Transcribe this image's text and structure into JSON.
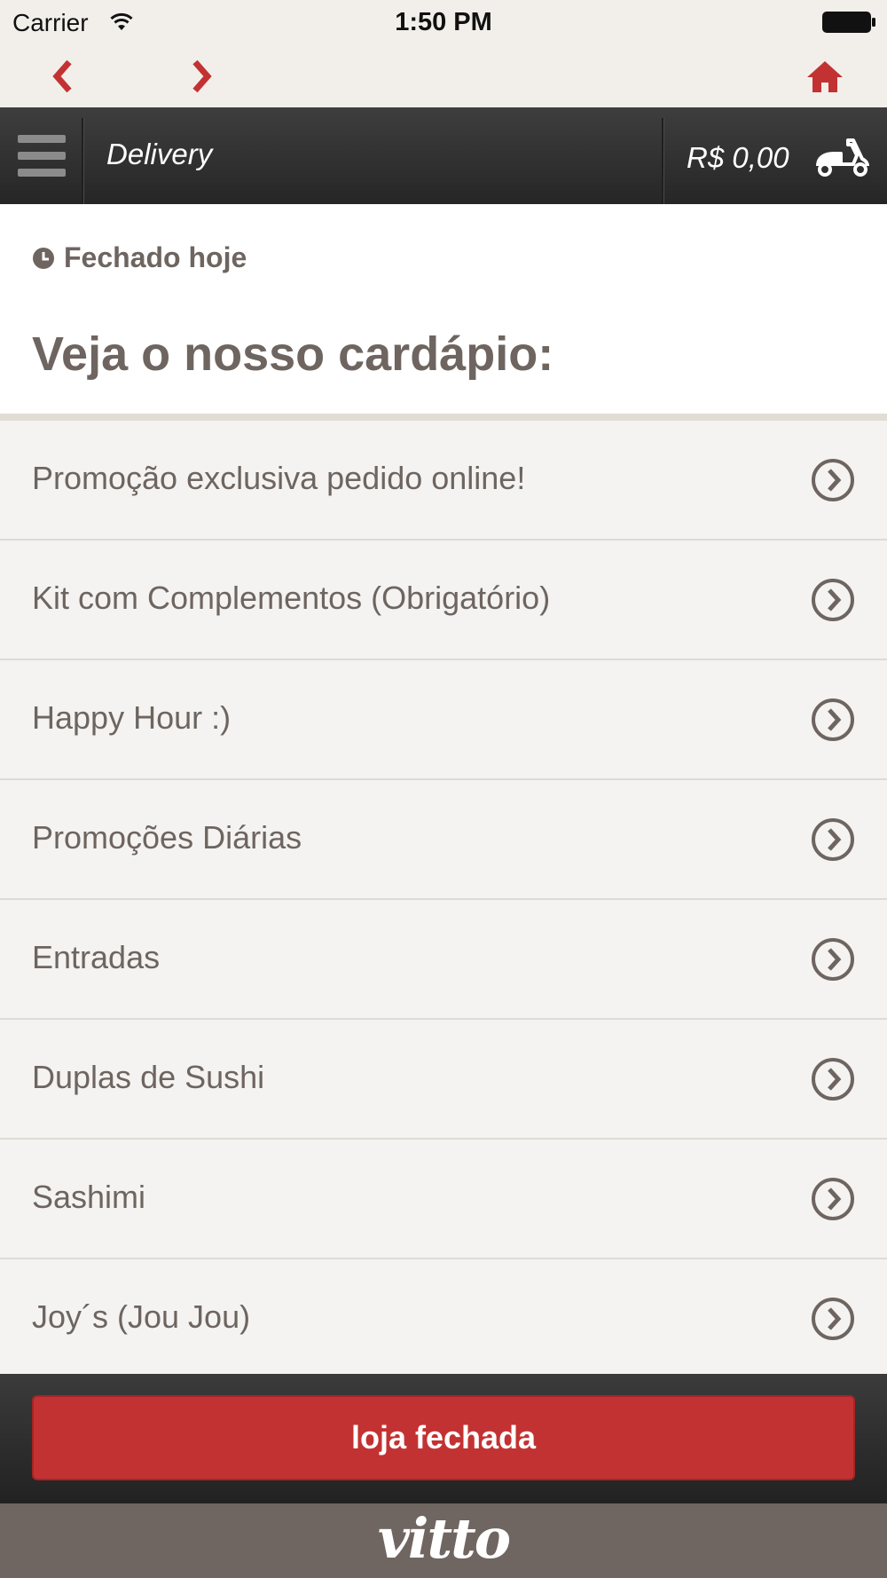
{
  "status_bar": {
    "carrier": "Carrier",
    "time": "1:50 PM"
  },
  "header": {
    "title": "Delivery",
    "cart_total": "R$ 0,00"
  },
  "store": {
    "hours_status": "Fechado hoje",
    "menu_heading": "Veja o nosso cardápio:"
  },
  "menu": {
    "items": [
      {
        "label": "Promoção exclusiva pedido online!"
      },
      {
        "label": "Kit com Complementos (Obrigatório)"
      },
      {
        "label": "Happy Hour :)"
      },
      {
        "label": "Promoções Diárias"
      },
      {
        "label": "Entradas"
      },
      {
        "label": "Duplas de Sushi"
      },
      {
        "label": "Sashimi"
      },
      {
        "label": "Joy´s (Jou Jou)"
      }
    ]
  },
  "footer": {
    "button_label": "loja fechada",
    "brand": "vitto"
  },
  "colors": {
    "accent": "#c33232",
    "text": "#6e6560",
    "header_bg": "#2f2f2f",
    "brand_bar": "#6f6662"
  },
  "icons": [
    "wifi-icon",
    "battery-icon",
    "back-arrow-icon",
    "forward-arrow-icon",
    "home-icon",
    "hamburger-menu-icon",
    "scooter-icon",
    "clock-icon",
    "chevron-right-circle-icon"
  ]
}
